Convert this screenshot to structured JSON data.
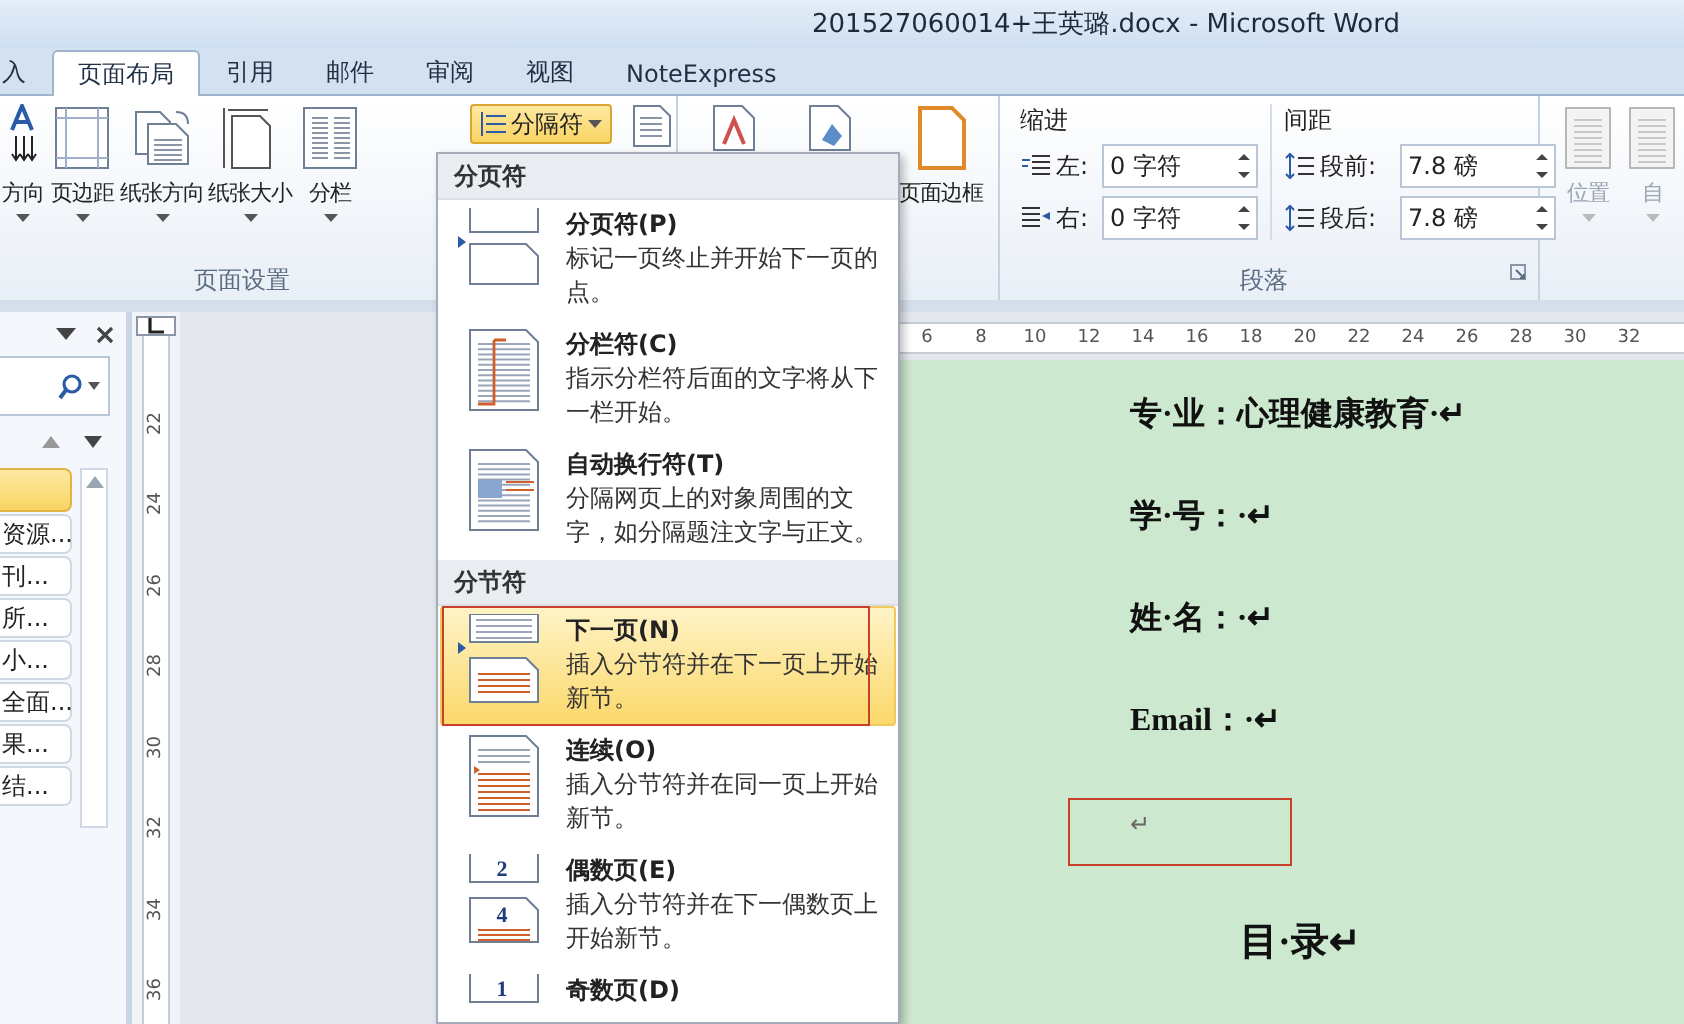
{
  "window": {
    "title": "201527060014+王英璐.docx - Microsoft Word"
  },
  "tabs": [
    {
      "label": "入",
      "selected": false
    },
    {
      "label": "页面布局",
      "selected": true
    },
    {
      "label": "引用",
      "selected": false
    },
    {
      "label": "邮件",
      "selected": false
    },
    {
      "label": "审阅",
      "selected": false
    },
    {
      "label": "视图",
      "selected": false
    },
    {
      "label": "NoteExpress",
      "selected": false
    }
  ],
  "ribbon": {
    "page_setup": {
      "label": "页面设置",
      "buttons": [
        {
          "kind": "text-direction",
          "label": "方向"
        },
        {
          "kind": "margins",
          "label": "页边距"
        },
        {
          "kind": "orientation",
          "label": "纸张方向"
        },
        {
          "kind": "size",
          "label": "纸张大小"
        },
        {
          "kind": "columns",
          "label": "分栏"
        }
      ],
      "breaks_button": {
        "label": "分隔符",
        "expanded": true
      }
    },
    "page_background": {
      "buttons": [
        {
          "kind": "watermark"
        },
        {
          "kind": "page-color"
        },
        {
          "kind": "page-border",
          "label": "页面边框"
        }
      ]
    },
    "paragraph": {
      "label": "段落",
      "indent": {
        "title": "缩进",
        "left": {
          "label": "左:",
          "value": "0 字符"
        },
        "right": {
          "label": "右:",
          "value": "0 字符"
        }
      },
      "spacing": {
        "title": "间距",
        "before": {
          "label": "段前:",
          "value": "7.8 磅"
        },
        "after": {
          "label": "段后:",
          "value": "7.8 磅"
        }
      }
    },
    "arrange": {
      "buttons": [
        {
          "label": "位置",
          "disabled": true
        },
        {
          "label": "自",
          "disabled": true
        }
      ]
    }
  },
  "navigation_pane": {
    "items": [
      {
        "selected": true
      },
      {
        "label": "资源...",
        "selected": false
      },
      {
        "label": "刊...",
        "selected": false
      },
      {
        "label": "所...",
        "selected": false
      },
      {
        "label": "小...",
        "selected": false
      },
      {
        "label": "全面...",
        "selected": false
      },
      {
        "label": "果...",
        "selected": false
      },
      {
        "label": "结...",
        "selected": false
      }
    ]
  },
  "vertical_ruler": [
    "22",
    "24",
    "26",
    "28",
    "30",
    "32",
    "34",
    "36"
  ],
  "horizontal_ruler": [
    "6",
    "8",
    "10",
    "12",
    "14",
    "16",
    "18",
    "20",
    "22",
    "24",
    "26",
    "28",
    "30",
    "32"
  ],
  "document": {
    "paragraphs": [
      {
        "kind": "body",
        "text": "专·业：心理健康教育·↵",
        "annotated": false
      },
      {
        "kind": "body",
        "text": "学·号：·↵",
        "annotated": false
      },
      {
        "kind": "body",
        "text": "姓·名：·↵",
        "annotated": false
      },
      {
        "kind": "body",
        "text": "Email：·↵",
        "annotated": false
      },
      {
        "kind": "body",
        "text": "↵",
        "annotated": true
      },
      {
        "kind": "heading",
        "text": "目·录↵",
        "annotated": false
      }
    ]
  },
  "break_menu": {
    "sections": [
      {
        "header": "分页符",
        "items": [
          {
            "kind": "page",
            "title": "分页符(P)",
            "description": "标记一页终止并开始下一页的点。",
            "selected": false,
            "annotated": false
          },
          {
            "kind": "column",
            "title": "分栏符(C)",
            "description": "指示分栏符后面的文字将从下一栏开始。",
            "selected": false,
            "annotated": false
          },
          {
            "kind": "text-wrap",
            "title": "自动换行符(T)",
            "description": "分隔网页上的对象周围的文字，如分隔题注文字与正文。",
            "selected": false,
            "annotated": false
          }
        ]
      },
      {
        "header": "分节符",
        "items": [
          {
            "kind": "next-page",
            "title": "下一页(N)",
            "description": "插入分节符并在下一页上开始新节。",
            "selected": true,
            "annotated": true
          },
          {
            "kind": "continuous",
            "title": "连续(O)",
            "description": "插入分节符并在同一页上开始新节。",
            "selected": false,
            "annotated": false
          },
          {
            "kind": "even-page",
            "title": "偶数页(E)",
            "description": "插入分节符并在下一偶数页上开始新节。",
            "icon_numbers": [
              "2",
              "4"
            ],
            "selected": false,
            "annotated": false
          },
          {
            "kind": "odd-page",
            "title": "奇数页(D)",
            "icon_numbers": [
              "1"
            ],
            "selected": false,
            "annotated": false
          }
        ]
      }
    ]
  }
}
